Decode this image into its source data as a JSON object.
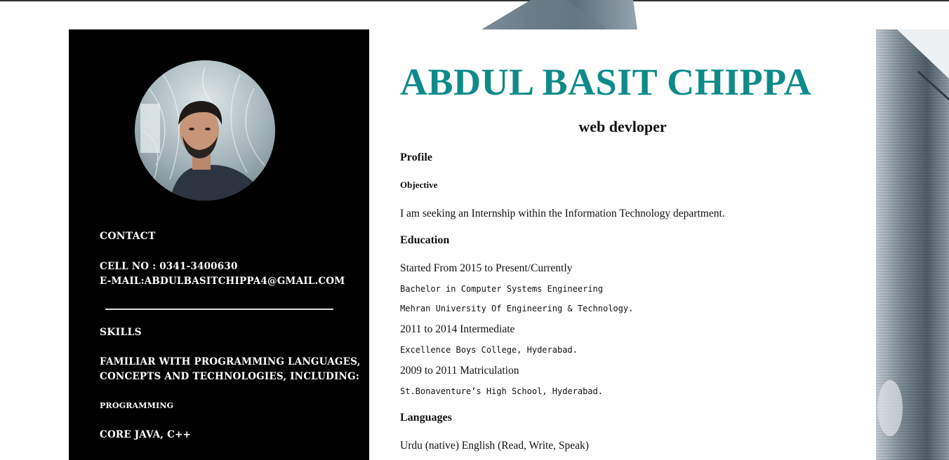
{
  "sidebar": {
    "contact_heading": "Contact",
    "cell": "Cell No : 0341-3400630",
    "email": "E-mail:abdulbasitchippa4@gmail.com",
    "skills_heading": "Skills",
    "skills_intro_line1": "Familiar with programming languages,",
    "skills_intro_line2": "concepts and technologies, including:",
    "programming_heading": "Programming",
    "programming_list": "Core Java, C++"
  },
  "main": {
    "name": "ABDUL BASIT CHIPPA",
    "role": "web devloper",
    "profile_heading": "Profile",
    "objective_heading": "Objective",
    "objective_text": "I am seeking an Internship within the Information Technology department.",
    "education_heading": "Education",
    "education": [
      {
        "period": "Started From 2015 to Present/Currently",
        "lines": [
          "Bachelor in Computer Systems Engineering",
          "Mehran University Of Engineering & Technology."
        ]
      },
      {
        "period": "2011 to 2014 Intermediate",
        "lines": [
          "Excellence Boys College, Hyderabad."
        ]
      },
      {
        "period": "2009 to 2011 Matriculation",
        "lines": [
          "St.Bonaventure’s High School, Hyderabad."
        ]
      }
    ],
    "languages_heading": "Languages",
    "languages_text": "Urdu (native) English (Read, Write, Speak)"
  },
  "colors": {
    "accent": "#0f8a8a",
    "sidebar_bg": "#000000",
    "page_bg": "#ffffff"
  },
  "icons": [
    "profile-photo"
  ]
}
